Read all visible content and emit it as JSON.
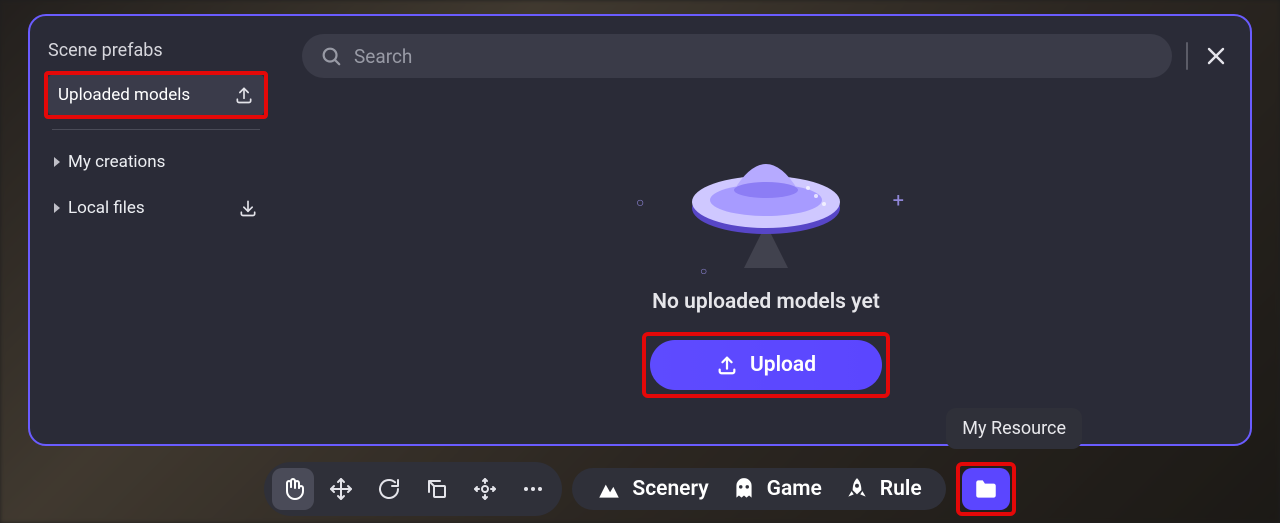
{
  "panel": {
    "sidebar": {
      "title": "Scene prefabs",
      "items": [
        {
          "label": "Uploaded models",
          "active": true,
          "icon": "upload-icon"
        },
        {
          "label": "My creations",
          "active": false,
          "icon": "chevron"
        },
        {
          "label": "Local files",
          "active": false,
          "icon": "import-icon"
        }
      ]
    },
    "search": {
      "placeholder": "Search",
      "value": ""
    },
    "empty_state": {
      "message": "No uploaded models yet",
      "button_label": "Upload"
    }
  },
  "tooltip": "My Resource",
  "bottombar": {
    "tools": [
      {
        "name": "hand-tool",
        "active": true
      },
      {
        "name": "move-tool",
        "active": false
      },
      {
        "name": "rotate-tool",
        "active": false
      },
      {
        "name": "scale-tool",
        "active": false
      },
      {
        "name": "transform-tool",
        "active": false
      },
      {
        "name": "more-tool",
        "active": false
      }
    ],
    "modes": [
      {
        "label": "Scenery",
        "icon": "mountain-icon"
      },
      {
        "label": "Game",
        "icon": "ghost-icon"
      },
      {
        "label": "Rule",
        "icon": "rocket-icon"
      }
    ]
  },
  "colors": {
    "accent": "#5b46ff",
    "highlight": "#e40808",
    "panel_bg": "#2a2b37"
  }
}
